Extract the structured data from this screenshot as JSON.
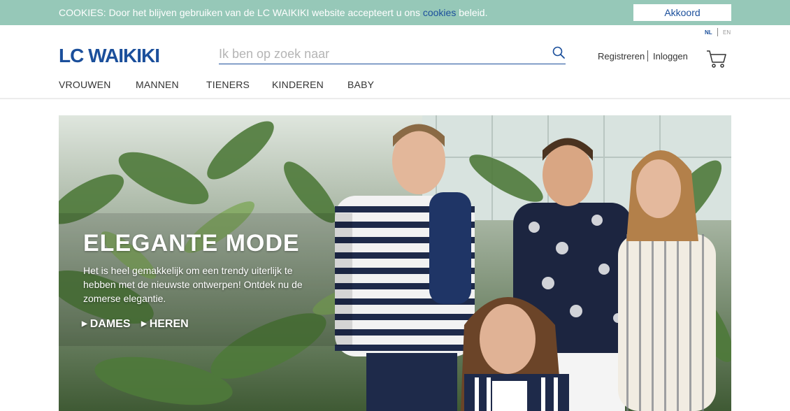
{
  "cookie": {
    "text": "COOKIES: Door het blijven gebruiken van de LC WAIKIKI website accepteert u ons ",
    "link": "cookies",
    "suffix": " beleid.",
    "accept_label": "Akkoord"
  },
  "lang": {
    "nl": "NL",
    "en": "EN"
  },
  "logo": "LC WAIKIKI",
  "search": {
    "placeholder": "Ik ben op zoek naar",
    "icon": "search-icon"
  },
  "account": {
    "register": "Registreren",
    "login": "Inloggen",
    "cart_icon": "cart-icon"
  },
  "nav": [
    {
      "label": "VROUWEN"
    },
    {
      "label": "MANNEN"
    },
    {
      "label": "TIENERS"
    },
    {
      "label": "KINDEREN"
    },
    {
      "label": "BABY"
    }
  ],
  "hero": {
    "title": "ELEGANTE MODE",
    "text": "Het is heel gemakkelijk om een trendy uiterlijk te hebben met de nieuwste ontwerpen! Ontdek nu de zomerse elegantie.",
    "links": [
      {
        "label": "DAMES"
      },
      {
        "label": "HEREN"
      }
    ]
  },
  "colors": {
    "brand": "#1b4f9b",
    "cookie_bar": "#96c8b8"
  }
}
